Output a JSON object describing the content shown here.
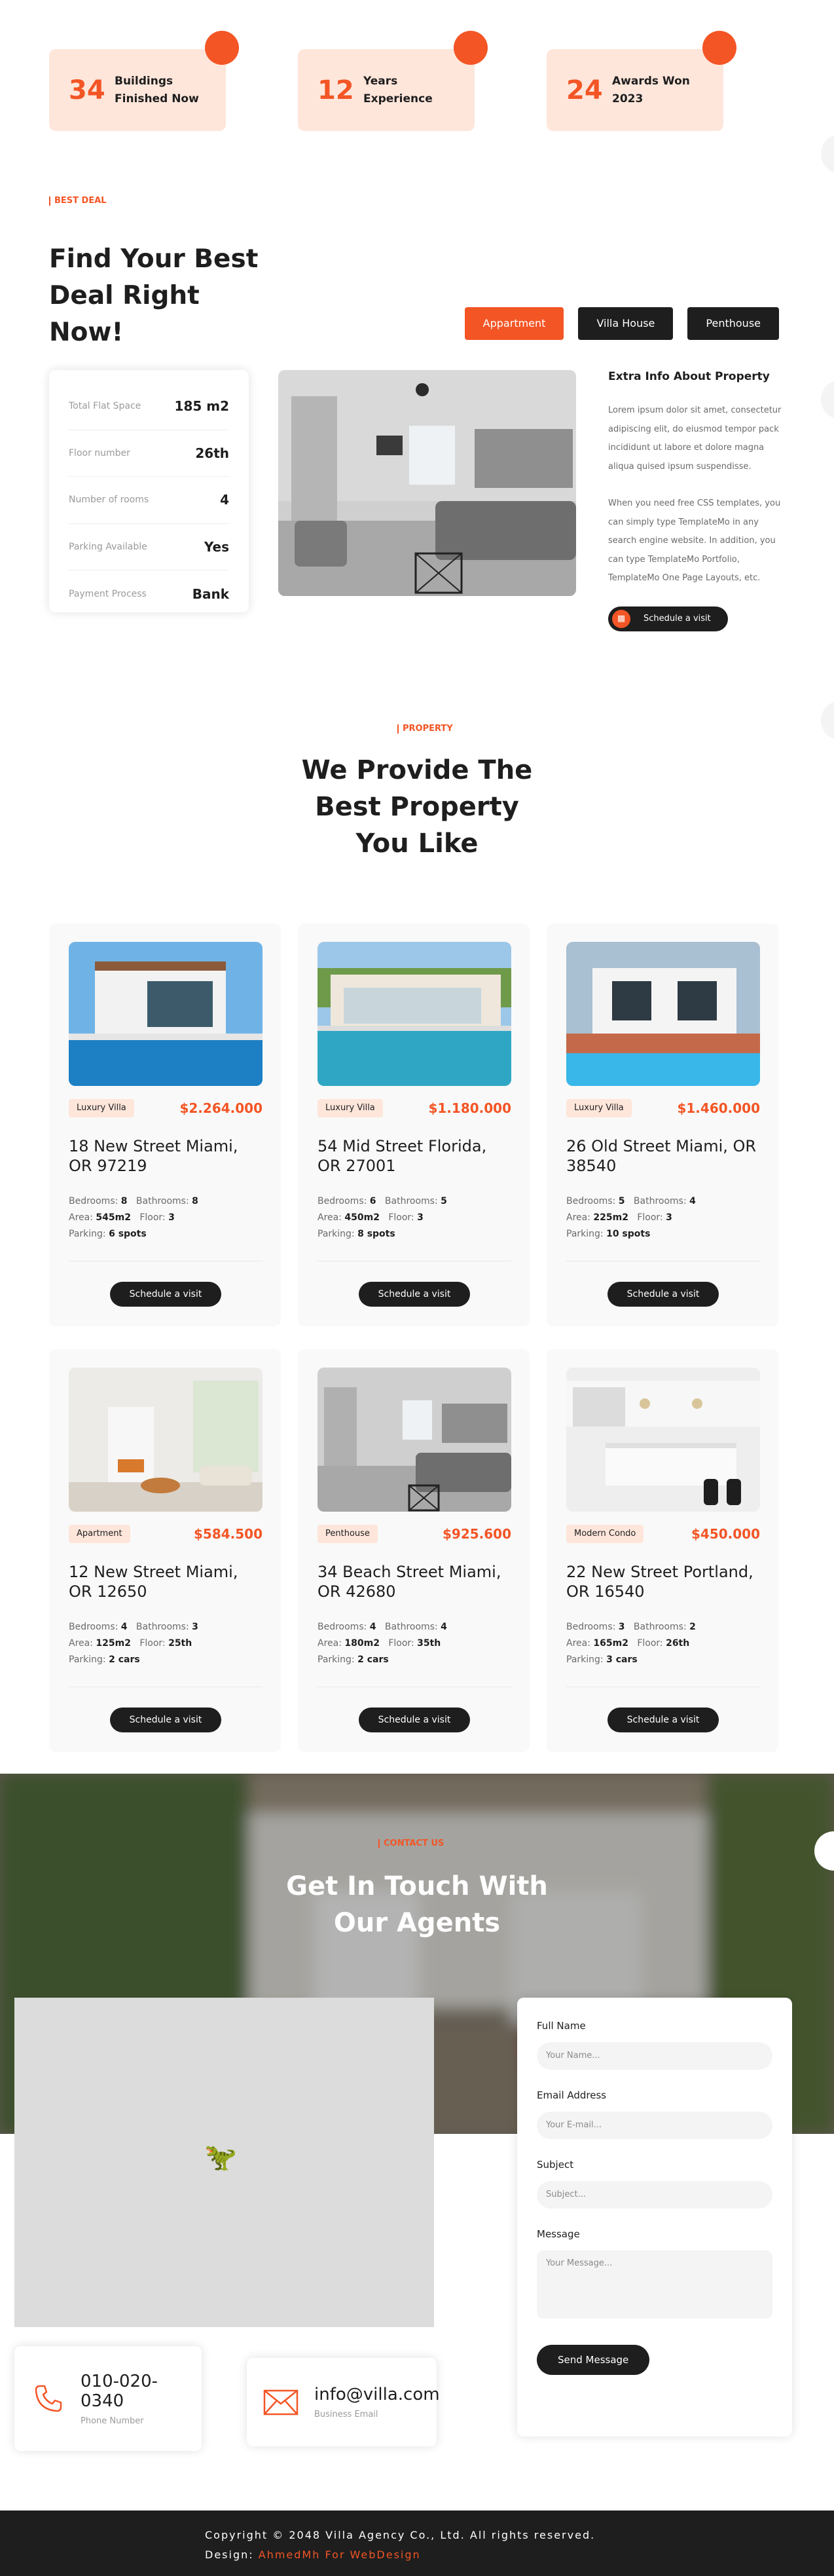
{
  "counters": [
    {
      "number": "34",
      "label": "Buildings Finished Now"
    },
    {
      "number": "12",
      "label": "Years Experience"
    },
    {
      "number": "24",
      "label": "Awards Won 2023"
    }
  ],
  "best_deal": {
    "kicker": "Best Deal",
    "title": "Find Your Best Deal Right Now!",
    "tabs": [
      "Appartment",
      "Villa House",
      "Penthouse"
    ],
    "info": [
      {
        "key": "Total Flat Space",
        "value": "185 m2"
      },
      {
        "key": "Floor number",
        "value": "26th"
      },
      {
        "key": "Number of rooms",
        "value": "4"
      },
      {
        "key": "Parking Available",
        "value": "Yes"
      },
      {
        "key": "Payment Process",
        "value": "Bank"
      }
    ],
    "extra_title": "Extra Info About Property",
    "paragraph1": "Lorem ipsum dolor sit amet, consectetur adipiscing elit, do eiusmod tempor pack incididunt ut labore et dolore magna aliqua quised ipsum suspendisse.",
    "paragraph2": "When you need free CSS templates, you can simply type TemplateMo in any search engine website. In addition, you can type TemplateMo Portfolio, TemplateMo One Page Layouts, etc.",
    "visit_label": "Schedule a visit"
  },
  "property": {
    "kicker": "Property",
    "title": "We Provide The Best Property You Like",
    "cards": [
      {
        "category": "Luxury Villa",
        "price": "$2.264.000",
        "address": "18 New Street Miami, OR 97219",
        "bedrooms": "8",
        "bathrooms": "8",
        "area": "545m2",
        "floor": "3",
        "parking": "6 spots",
        "button": "Schedule a visit"
      },
      {
        "category": "Luxury Villa",
        "price": "$1.180.000",
        "address": "54 Mid Street Florida, OR 27001",
        "bedrooms": "6",
        "bathrooms": "5",
        "area": "450m2",
        "floor": "3",
        "parking": "8 spots",
        "button": "Schedule a visit"
      },
      {
        "category": "Luxury Villa",
        "price": "$1.460.000",
        "address": "26 Old Street Miami, OR 38540",
        "bedrooms": "5",
        "bathrooms": "4",
        "area": "225m2",
        "floor": "3",
        "parking": "10 spots",
        "button": "Schedule a visit"
      },
      {
        "category": "Apartment",
        "price": "$584.500",
        "address": "12 New Street Miami, OR 12650",
        "bedrooms": "4",
        "bathrooms": "3",
        "area": "125m2",
        "floor": "25th",
        "parking": "2 cars",
        "button": "Schedule a visit"
      },
      {
        "category": "Penthouse",
        "price": "$925.600",
        "address": "34 Beach Street Miami, OR 42680",
        "bedrooms": "4",
        "bathrooms": "4",
        "area": "180m2",
        "floor": "35th",
        "parking": "2 cars",
        "button": "Schedule a visit"
      },
      {
        "category": "Modern Condo",
        "price": "$450.000",
        "address": "22 New Street Portland, OR 16540",
        "bedrooms": "3",
        "bathrooms": "2",
        "area": "165m2",
        "floor": "26th",
        "parking": "3 cars",
        "button": "Schedule a visit"
      }
    ],
    "spec_labels": {
      "bedrooms": "Bedrooms:",
      "bathrooms": "Bathrooms:",
      "area": "Area:",
      "floor": "Floor:",
      "parking": "Parking:"
    }
  },
  "contact": {
    "kicker": "Contact Us",
    "title": "Get In Touch With Our Agents",
    "form": {
      "full_name_label": "Full Name",
      "full_name_placeholder": "Your Name...",
      "email_label": "Email Address",
      "email_placeholder": "Your E-mail...",
      "subject_label": "Subject",
      "subject_placeholder": "Subject...",
      "message_label": "Message",
      "message_placeholder": "Your Message...",
      "send_label": "Send Message"
    },
    "phone": {
      "value": "010-020-0340",
      "label": "Phone Number"
    },
    "email": {
      "value": "info@villa.com",
      "label": "Business Email"
    }
  },
  "footer": {
    "copyright": "Copyright © 2048 Villa Agency Co., Ltd. All rights reserved.",
    "design_prefix": "Design:",
    "design_credit": "AhmedMh For WebDesign"
  },
  "colors": {
    "accent": "#f35525",
    "dark": "#1e1e1e",
    "soft": "#fee6db"
  }
}
